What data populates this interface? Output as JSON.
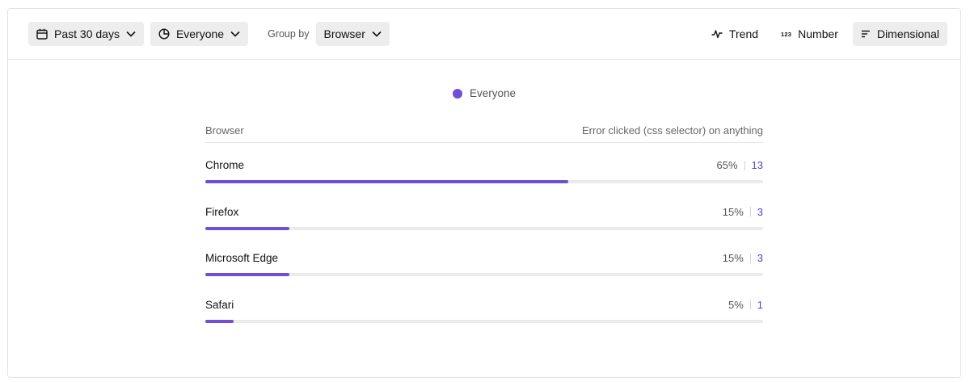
{
  "toolbar": {
    "date_range": "Past 30 days",
    "cohort": "Everyone",
    "group_by_label": "Group by",
    "group_by_value": "Browser",
    "views": [
      {
        "label": "Trend",
        "icon": "trend-icon",
        "active": false
      },
      {
        "label": "Number",
        "icon": "number-icon",
        "glyph": "123",
        "active": false
      },
      {
        "label": "Dimensional",
        "icon": "dimensional-icon",
        "active": true
      }
    ]
  },
  "legend": {
    "label": "Everyone",
    "color": "#6e4fd6"
  },
  "table": {
    "col_dimension": "Browser",
    "col_metric": "Error clicked (css selector) on anything"
  },
  "chart_data": {
    "type": "bar",
    "categories": [
      "Chrome",
      "Firefox",
      "Microsoft Edge",
      "Safari"
    ],
    "series": [
      {
        "name": "Everyone",
        "values": [
          13,
          3,
          3,
          1
        ],
        "percent_labels": [
          "65%",
          "15%",
          "15%",
          "5%"
        ]
      }
    ]
  },
  "colors": {
    "accent": "#6e4fd6",
    "count_text": "#5a3fc8",
    "track": "#ebebeb"
  }
}
